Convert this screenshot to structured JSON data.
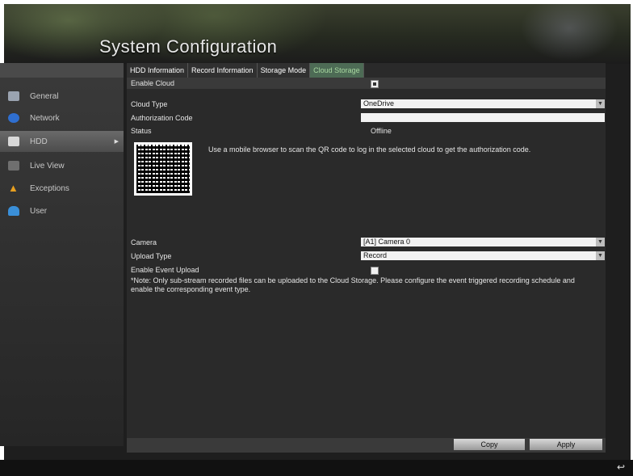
{
  "title": "System Configuration",
  "sidebar": {
    "items": [
      {
        "label": "General",
        "icon": "general-icon",
        "color": "#9aa3b0"
      },
      {
        "label": "Network",
        "icon": "network-icon",
        "color": "#2f6fd0"
      },
      {
        "label": "HDD",
        "icon": "hdd-icon",
        "color": "#d8d8d8"
      },
      {
        "label": "Live View",
        "icon": "live-view-icon",
        "color": "#7a7a7a"
      },
      {
        "label": "Exceptions",
        "icon": "warning-icon",
        "color": "#e8a020"
      },
      {
        "label": "User",
        "icon": "user-icon",
        "color": "#3a8fd8"
      }
    ],
    "active": "HDD"
  },
  "tabs": [
    {
      "label": "HDD Information",
      "active": false
    },
    {
      "label": "Record Information",
      "active": false
    },
    {
      "label": "Storage Mode",
      "active": false
    },
    {
      "label": "Cloud Storage",
      "active": true
    }
  ],
  "form": {
    "enable_cloud_label": "Enable Cloud",
    "enable_cloud_checked": true,
    "cloud_type_label": "Cloud Type",
    "cloud_type_value": "OneDrive",
    "auth_code_label": "Authorization Code",
    "auth_code_value": "",
    "status_label": "Status",
    "status_value": "Offline",
    "qr_hint": "Use a mobile browser to scan the QR code to log in the selected cloud to get the authorization code.",
    "camera_label": "Camera",
    "camera_value": "[A1] Camera 0",
    "upload_type_label": "Upload Type",
    "upload_type_value": "Record",
    "event_upload_label": "Enable Event Upload",
    "event_upload_checked": false,
    "note": "*Note: Only sub-stream recorded files can be uploaded to the Cloud Storage. Please configure the event triggered recording schedule and enable the corresponding event type."
  },
  "buttons": {
    "copy": "Copy",
    "apply": "Apply"
  },
  "colors": {
    "active_tab": "#4d6b55",
    "active_tab_text": "#a8d8a0"
  }
}
